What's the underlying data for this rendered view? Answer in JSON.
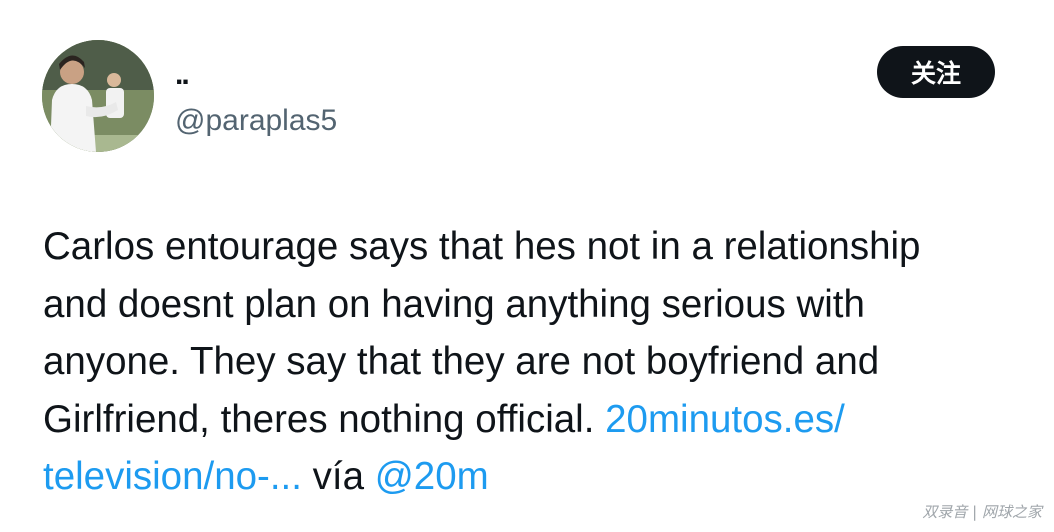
{
  "tweet": {
    "author": {
      "display_name": "..",
      "handle": "@paraplas5",
      "avatar_icon": "profile-photo"
    },
    "follow_label": "关注",
    "text_lines": [
      "Carlos entourage says that hes not in a relationship",
      "and doesnt plan on having  anything serious with",
      "anyone. They say that they are not boyfriend and",
      "Girlfriend, theres nothing official."
    ],
    "link_part1": "20minutos.es/",
    "link_part2": "television/no-...",
    "via_text": "vía",
    "mention": "@20m"
  },
  "watermark": "双录音 | 网球之家",
  "colors": {
    "link": "#1d9bf0",
    "follow_bg": "#0f1419",
    "handle": "#536471"
  }
}
